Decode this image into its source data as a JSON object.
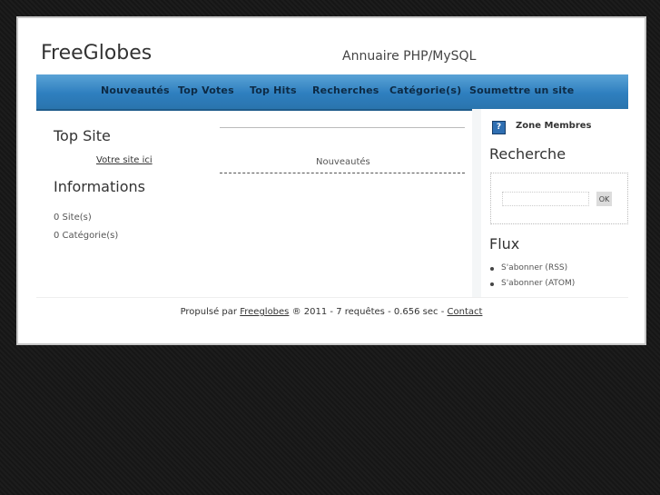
{
  "header": {
    "site_name": "FreeGlobes",
    "slogan": "Annuaire PHP/MySQL"
  },
  "nav": {
    "items": [
      "Nouveautés",
      "Top Votes",
      "Top Hits",
      "Recherches",
      "Catégorie(s)",
      "Soumettre un site"
    ]
  },
  "left": {
    "top_site_title": "Top Site",
    "top_site_link": "Votre site ici",
    "info_title": "Informations",
    "sites_count": "0 Site(s)",
    "categories_count": "0 Catégorie(s)"
  },
  "center": {
    "heading": "Nouveautés"
  },
  "right": {
    "members_label": "Zone Membres",
    "members_icon": "help-icon",
    "search_title": "Recherche",
    "search_value": "",
    "search_button": "OK",
    "flux_title": "Flux",
    "flux_items": [
      "S'abonner (RSS)",
      "S'abonner (ATOM)"
    ]
  },
  "footer": {
    "propulse": "Propulsé par",
    "brand": "Freeglobes",
    "info": "® 2011 - 7 requêtes - 0.656 sec -",
    "contact": "Contact"
  },
  "colors": {
    "nav_gradient_top": "#5aa3d6",
    "nav_gradient_bottom": "#2a74ad",
    "background": "#1a1a1a"
  }
}
